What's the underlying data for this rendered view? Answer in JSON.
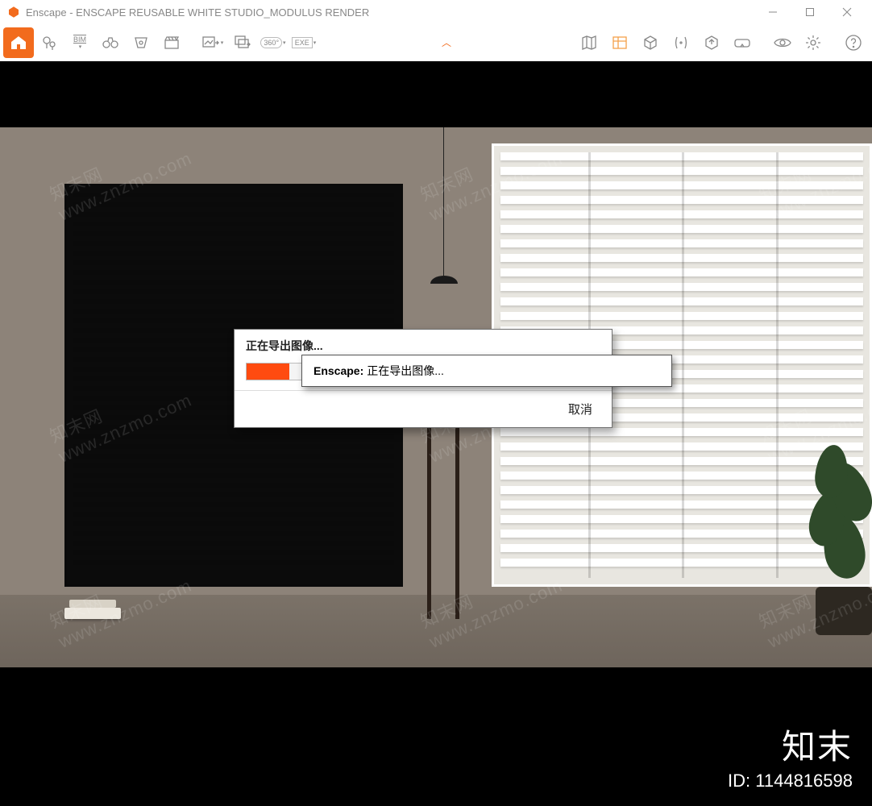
{
  "window": {
    "app_name": "Enscape",
    "title_sep": " - ",
    "document": "ENSCAPE REUSABLE WHITE STUDIO_MODULUS RENDER"
  },
  "toolbar": {
    "bim_label": "BIM",
    "panorama_label": "360°",
    "exe_label": "EXE"
  },
  "dialog": {
    "title": "正在导出图像...",
    "progress_percent": 12,
    "cancel": "取消"
  },
  "dialog2": {
    "app": "Enscape:",
    "msg": "正在导出图像..."
  },
  "watermark": {
    "text": "www.znzmo.com",
    "brand_cn": "知末网"
  },
  "footer": {
    "brand": "知末",
    "id_label": "ID: ",
    "id_value": "1144816598"
  },
  "colors": {
    "accent": "#f26b1d",
    "progress": "#ff4b10"
  }
}
